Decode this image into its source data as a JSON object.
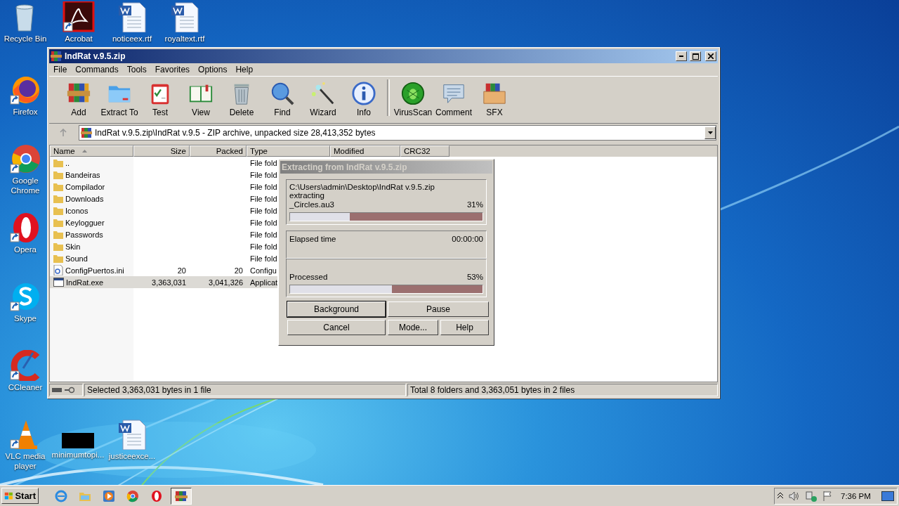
{
  "desktop_icons": [
    {
      "label": "Recycle Bin",
      "kind": "recycle"
    },
    {
      "label": "Acrobat",
      "kind": "acrobat"
    },
    {
      "label": "noticeex.rtf",
      "kind": "word"
    },
    {
      "label": "royaltext.rtf",
      "kind": "word"
    },
    {
      "label": "Firefox",
      "kind": "firefox"
    },
    {
      "label": "Google Chrome",
      "kind": "chrome"
    },
    {
      "label": "Opera",
      "kind": "opera"
    },
    {
      "label": "Skype",
      "kind": "skype"
    },
    {
      "label": "CCleaner",
      "kind": "ccleaner"
    },
    {
      "label": "VLC media player",
      "kind": "vlc"
    },
    {
      "label": "minimumtopi...",
      "kind": "black"
    },
    {
      "label": "justiceexce...",
      "kind": "word"
    }
  ],
  "window": {
    "title": "IndRat v.9.5.zip",
    "menu": [
      "File",
      "Commands",
      "Tools",
      "Favorites",
      "Options",
      "Help"
    ],
    "toolbar": [
      [
        {
          "label": "Add",
          "kind": "add"
        },
        {
          "label": "Extract To",
          "kind": "extract"
        },
        {
          "label": "Test",
          "kind": "test"
        },
        {
          "label": "View",
          "kind": "view"
        },
        {
          "label": "Delete",
          "kind": "delete"
        },
        {
          "label": "Find",
          "kind": "find"
        },
        {
          "label": "Wizard",
          "kind": "wizard"
        },
        {
          "label": "Info",
          "kind": "info"
        }
      ],
      [
        {
          "label": "VirusScan",
          "kind": "virus"
        },
        {
          "label": "Comment",
          "kind": "comment"
        },
        {
          "label": "SFX",
          "kind": "sfx"
        }
      ]
    ],
    "address": "IndRat v.9.5.zip\\IndRat v.9.5 - ZIP archive, unpacked size 28,413,352 bytes",
    "columns": [
      {
        "label": "Name",
        "sorted": true
      },
      {
        "label": "Size",
        "sorted": false
      },
      {
        "label": "Packed",
        "sorted": false
      },
      {
        "label": "Type",
        "sorted": false
      },
      {
        "label": "Modified",
        "sorted": false
      },
      {
        "label": "CRC32",
        "sorted": false
      }
    ],
    "rows": [
      {
        "name": "..",
        "size": "",
        "packed": "",
        "type": "File fold",
        "kind": "folder",
        "selected": false
      },
      {
        "name": "Bandeiras",
        "size": "",
        "packed": "",
        "type": "File fold",
        "kind": "folder",
        "selected": false
      },
      {
        "name": "Compilador",
        "size": "",
        "packed": "",
        "type": "File fold",
        "kind": "folder",
        "selected": false
      },
      {
        "name": "Downloads",
        "size": "",
        "packed": "",
        "type": "File fold",
        "kind": "folder",
        "selected": false
      },
      {
        "name": "Iconos",
        "size": "",
        "packed": "",
        "type": "File fold",
        "kind": "folder",
        "selected": false
      },
      {
        "name": "Keylogguer",
        "size": "",
        "packed": "",
        "type": "File fold",
        "kind": "folder",
        "selected": false
      },
      {
        "name": "Passwords",
        "size": "",
        "packed": "",
        "type": "File fold",
        "kind": "folder",
        "selected": false
      },
      {
        "name": "Skin",
        "size": "",
        "packed": "",
        "type": "File fold",
        "kind": "folder",
        "selected": false
      },
      {
        "name": "Sound",
        "size": "",
        "packed": "",
        "type": "File fold",
        "kind": "folder",
        "selected": false
      },
      {
        "name": "ConfigPuertos.ini",
        "size": "20",
        "packed": "20",
        "type": "Configu",
        "kind": "ini",
        "selected": false
      },
      {
        "name": "IndRat.exe",
        "size": "3,363,031",
        "packed": "3,041,326",
        "type": "Applicat",
        "kind": "exe",
        "selected": true
      }
    ],
    "status_left": "Selected 3,363,031 bytes in 1 file",
    "status_right": "Total 8 folders and 3,363,051 bytes in 2 files"
  },
  "dialog": {
    "title": "Extracting from IndRat v.9.5.zip",
    "archive_path": "C:\\Users\\admin\\Desktop\\IndRat v.9.5.zip",
    "action": "extracting",
    "file": "_Circles.au3",
    "file_percent": "31%",
    "file_progress": {
      "level": 0.31
    },
    "elapsed_label": "Elapsed time",
    "elapsed": "00:00:00",
    "processed_label": "Processed",
    "processed_percent": "53%",
    "processed_progress": {
      "level": 0.53
    },
    "buttons": [
      {
        "label": "Background",
        "default": true
      },
      {
        "label": "Pause",
        "default": false
      },
      {
        "label": "Cancel",
        "default": false
      },
      {
        "label": "Mode...",
        "default": false
      },
      {
        "label": "Help",
        "default": false
      }
    ]
  },
  "taskbar": {
    "start": "Start",
    "apps": [
      {
        "kind": "ie",
        "active": false
      },
      {
        "kind": "explorer",
        "active": false
      },
      {
        "kind": "media",
        "active": false
      },
      {
        "kind": "chrome",
        "active": false
      },
      {
        "kind": "opera",
        "active": false
      },
      {
        "kind": "winrar",
        "active": true
      }
    ],
    "time": "7:36 PM"
  }
}
